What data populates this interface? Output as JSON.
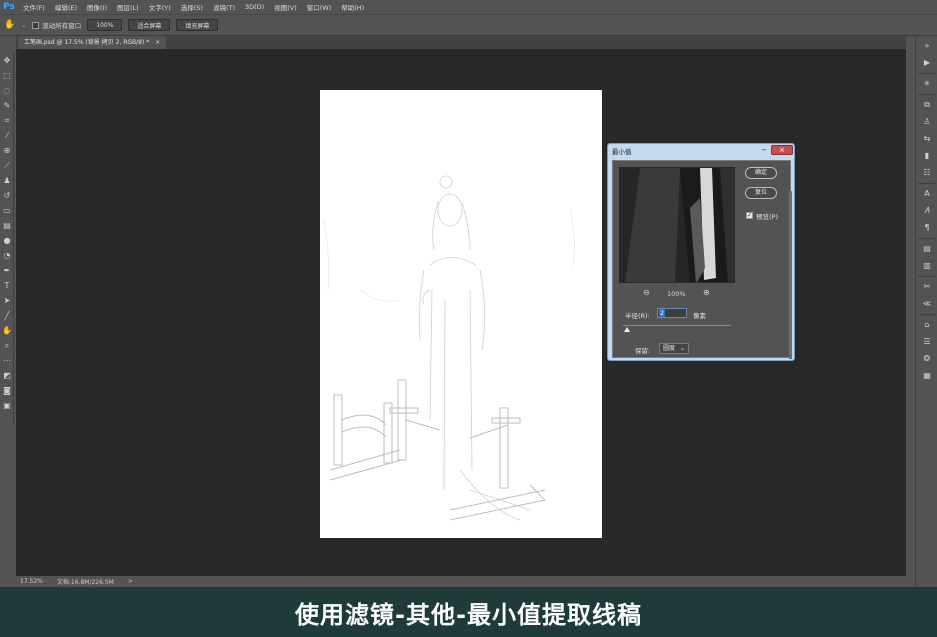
{
  "app_logo": "Ps",
  "menu": [
    "文件(F)",
    "编辑(E)",
    "图像(I)",
    "图层(L)",
    "文字(Y)",
    "选择(S)",
    "滤镜(T)",
    "3D(D)",
    "视图(V)",
    "窗口(W)",
    "帮助(H)"
  ],
  "options": {
    "tool_icon": "hand-icon",
    "scroll_all_label": "滚动所有窗口",
    "zoom_button": "100%",
    "fit_screen_button": "适合屏幕",
    "fill_screen_button": "填充屏幕"
  },
  "document": {
    "tab_title": "工笔画.psd @ 17.5% (背景 拷贝 2, RGB/8) *",
    "tab_close": "×"
  },
  "status": {
    "zoom": "17.52%",
    "doc_size": "文档:16.8M/226.5M",
    "arrow": ">"
  },
  "dialog": {
    "title": "最小值",
    "close": "×",
    "minimize": "−",
    "ok_label": "确定",
    "reset_label": "复位",
    "preview_label": "预览(P)",
    "preview_checked": "✓",
    "zoom_out": "⊖",
    "zoom_in": "⊕",
    "zoom_level": "100%",
    "radius_label": "半径(R):",
    "radius_value": "2",
    "radius_unit": "像素",
    "radius_fraction": 0.02,
    "preserve_label": "保留:",
    "preserve_value": "圆度"
  },
  "caption": "使用滤镜-其他-最小值提取线稿",
  "colors": {
    "accent": "#31a8ff",
    "caption_bg": "#1e3b3a",
    "dialog_frame": "#c4d9ef",
    "close_button": "#c45151"
  }
}
